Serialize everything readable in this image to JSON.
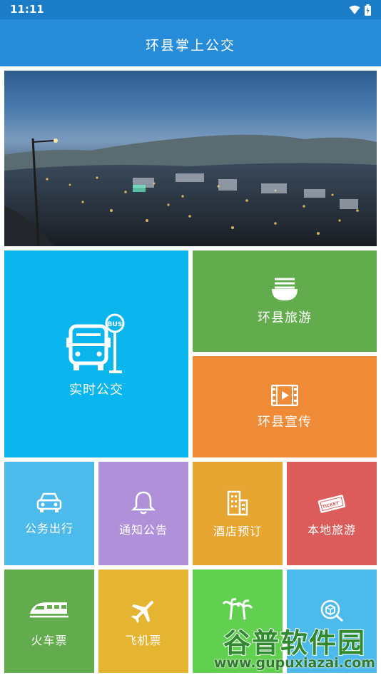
{
  "status_bar": {
    "time": "11:11"
  },
  "app": {
    "title": "环县掌上公交"
  },
  "banner": {
    "dots": 5,
    "active_dot": 2
  },
  "tiles": {
    "realtime_bus": {
      "label": "实时公交",
      "icon": "bus-stop-icon",
      "color": "#0bb6ef"
    },
    "tourism": {
      "label": "环县旅游",
      "icon": "noodle-bowl-icon",
      "color": "#63ac4d"
    },
    "promo": {
      "label": "环县宣传",
      "icon": "film-icon",
      "color": "#ef8a37"
    },
    "official_travel": {
      "label": "公务出行",
      "icon": "car-icon",
      "color": "#4dbaec"
    },
    "notice": {
      "label": "通知公告",
      "icon": "bell-icon",
      "color": "#b190da"
    },
    "hotel": {
      "label": "酒店预订",
      "icon": "building-icon",
      "color": "#e7a531"
    },
    "local_tour": {
      "label": "本地旅游",
      "icon": "ticket-icon",
      "color": "#dc5c5c"
    },
    "train": {
      "label": "火车票",
      "icon": "train-icon",
      "color": "#63ac4d"
    },
    "flight": {
      "label": "飞机票",
      "icon": "airplane-icon",
      "color": "#e5b431"
    },
    "scenic": {
      "label": "",
      "icon": "palm-tree-icon",
      "color": "#61cf4f"
    },
    "search": {
      "label": "",
      "icon": "search-box-icon",
      "color": "#4dbaec"
    }
  },
  "watermark": {
    "text": "谷普软件园",
    "url": "www.gupuxiazai.com"
  }
}
